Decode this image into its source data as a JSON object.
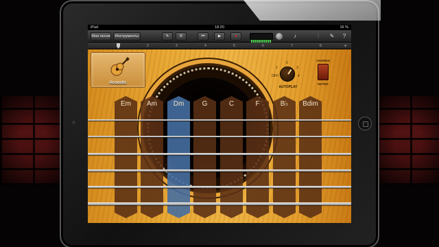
{
  "status_bar": {
    "carrier": "iPad",
    "time": "18:20",
    "battery": "16 %"
  },
  "toolbar": {
    "my_songs_label": "Мои песни",
    "instruments_label": "Инструменты",
    "icons": [
      "guitar-pick-icon",
      "track-view-icon",
      "rewind-icon",
      "play-icon",
      "record-icon",
      "level-meter",
      "volume-knob-icon",
      "metronome-icon",
      "mixer-icon",
      "wrench-icon",
      "help-icon"
    ]
  },
  "ruler": {
    "marks": [
      "1",
      "2",
      "3",
      "4",
      "5",
      "6",
      "7",
      "8"
    ],
    "add": "+"
  },
  "instrument": {
    "name": "Acoustic"
  },
  "autoplay": {
    "label": "AUTOPLAY",
    "off": "OFF",
    "positions": [
      "1",
      "2",
      "3",
      "4"
    ]
  },
  "chords_toggle": {
    "top_label": "CHORDS",
    "bottom_label": "NOTES"
  },
  "chords": [
    "Em",
    "Am",
    "Dm",
    "G",
    "C",
    "F",
    "B♭",
    "Bdim"
  ],
  "active_chord": "Dm",
  "colors": {
    "active_chord": "#466ea0",
    "wood": "#e9a935"
  }
}
